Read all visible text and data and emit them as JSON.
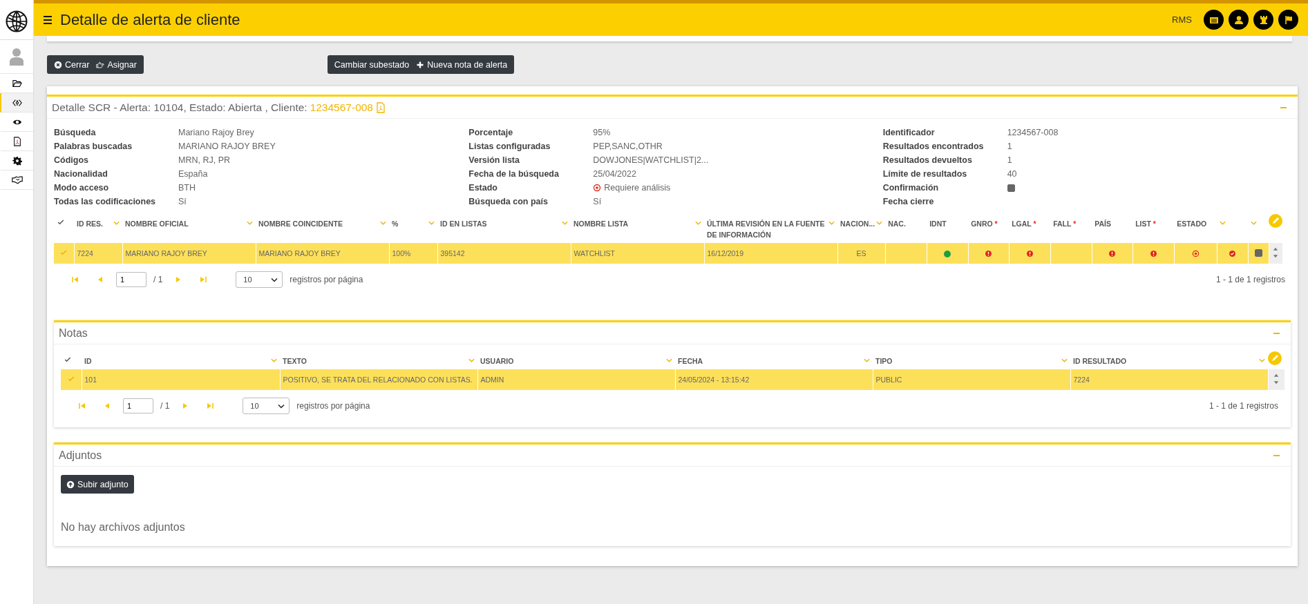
{
  "header": {
    "title": "Detalle de alerta de cliente",
    "user": "RMS",
    "buttons": [
      {
        "kind": "card"
      },
      {
        "kind": "user"
      },
      {
        "kind": "rook"
      },
      {
        "kind": "flag"
      }
    ]
  },
  "sidebar": {
    "items": [
      {
        "kind": "folder",
        "selected": false
      },
      {
        "kind": "code",
        "selected": true
      },
      {
        "kind": "eye",
        "selected": false
      },
      {
        "kind": "pdf",
        "selected": false
      },
      {
        "kind": "gear",
        "selected": false
      },
      {
        "kind": "handshake",
        "selected": false
      }
    ]
  },
  "toolbar": {
    "left": [
      {
        "label": "Cerrar",
        "kind": "close"
      },
      {
        "label": "Asignar",
        "kind": "hand"
      }
    ],
    "right": [
      {
        "label": "Cambiar subestado",
        "kind": "plain"
      },
      {
        "label": "Nueva nota de alerta",
        "kind": "plus"
      }
    ]
  },
  "detail": {
    "title": "Detalle SCR - Alerta: 10104, Estado: Abierta , Cliente:",
    "client_link": "1234567-008",
    "field_columns": [
      [
        {
          "label": "Búsqueda",
          "value": "Mariano Rajoy Brey",
          "kind": "text"
        },
        {
          "label": "Palabras buscadas",
          "value": "MARIANO RAJOY BREY",
          "kind": "text"
        },
        {
          "label": "Códigos",
          "value": "MRN, RJ, PR",
          "kind": "text"
        },
        {
          "label": "Nacionalidad",
          "value": "España",
          "kind": "text"
        },
        {
          "label": "Modo acceso",
          "value": "BTH",
          "kind": "text"
        },
        {
          "label": "Todas las codificaciones",
          "value": "Sí",
          "kind": "text"
        }
      ],
      [
        {
          "label": "Porcentaje",
          "value": "95%",
          "kind": "text"
        },
        {
          "label": "Listas configuradas",
          "value": "PEP,SANC,OTHR",
          "kind": "text"
        },
        {
          "label": "Versión lista",
          "value": "DOWJONES|WATCHLIST|2...",
          "kind": "text"
        },
        {
          "label": "Fecha de la búsqueda",
          "value": "25/04/2022",
          "kind": "text"
        },
        {
          "label": "Estado",
          "value": "Requiere análisis",
          "kind": "status"
        },
        {
          "label": "Búsqueda con país",
          "value": "Sí",
          "kind": "text"
        }
      ],
      [
        {
          "label": "Identificador",
          "value": "1234567-008",
          "kind": "text"
        },
        {
          "label": "Resultados encontrados",
          "value": "1",
          "kind": "text"
        },
        {
          "label": "Resultados devueltos",
          "value": "1",
          "kind": "text"
        },
        {
          "label": "Límite de resultados",
          "value": "40",
          "kind": "text"
        },
        {
          "label": "Confirmación",
          "kind": "checkbox",
          "checked": true
        },
        {
          "label": "Fecha cierre",
          "kind": "text"
        }
      ]
    ],
    "table": {
      "columns": [
        {
          "label": "ID RES.",
          "filter": true
        },
        {
          "label": "NOMBRE OFICIAL",
          "filter": true
        },
        {
          "label": "NOMBRE COINCIDENTE",
          "filter": true
        },
        {
          "label": "%",
          "filter": true
        },
        {
          "label": "ID EN LISTAS",
          "filter": true
        },
        {
          "label": "NOMBRE LISTA",
          "filter": true
        },
        {
          "label": "ÚLTIMA REVISIÓN EN LA FUENTE DE INFORMACIÓN",
          "filter": true
        },
        {
          "label": "NACION...",
          "filter": true
        },
        {
          "label": "NAC.",
          "filter": false
        },
        {
          "label": "IDNT",
          "filter": false
        },
        {
          "label": "GNRO",
          "required_mark": "*",
          "filter": false
        },
        {
          "label": "LGAL",
          "required_mark": "*",
          "filter": false
        },
        {
          "label": "FALL",
          "required_mark": "*",
          "filter": false
        },
        {
          "label": "PAÍS",
          "filter": false
        },
        {
          "label": "LIST",
          "required_mark": "*",
          "filter": false
        },
        {
          "label": "ESTADO",
          "filter": false
        },
        {
          "filter": true
        },
        {
          "filter": true
        }
      ],
      "rows": [
        {
          "selected": true,
          "cells": [
            {
              "kind": "text",
              "text": "7224"
            },
            {
              "kind": "text",
              "text": "MARIANO RAJOY BREY"
            },
            {
              "kind": "text",
              "text": "MARIANO RAJOY BREY"
            },
            {
              "kind": "text",
              "text": "100%"
            },
            {
              "kind": "text",
              "text": "395142"
            },
            {
              "kind": "text",
              "text": "WATCHLIST"
            },
            {
              "kind": "text",
              "text": "16/12/2019"
            },
            {
              "kind": "center",
              "text": "ES"
            },
            {
              "kind": "blank"
            },
            {
              "kind": "dot",
              "color": "#1e9e3e"
            },
            {
              "kind": "alert"
            },
            {
              "kind": "alert"
            },
            {
              "kind": "blank"
            },
            {
              "kind": "alert"
            },
            {
              "kind": "alert"
            },
            {
              "kind": "target"
            },
            {
              "kind": "check"
            },
            {
              "kind": "checkbox",
              "checked": true
            }
          ]
        }
      ],
      "pager": {
        "page": "1",
        "pages": "/ 1",
        "page_size": "10",
        "per_page": "registros por página",
        "summary": "1 - 1 de 1 registros"
      }
    }
  },
  "notes": {
    "title": "Notas",
    "table": {
      "columns": [
        {
          "label": "ID",
          "filter": true
        },
        {
          "label": "TEXTO",
          "filter": true
        },
        {
          "label": "USUARIO",
          "filter": true
        },
        {
          "label": "FECHA",
          "filter": true
        },
        {
          "label": "TIPO",
          "filter": true
        },
        {
          "label": "ID RESULTADO",
          "filter": true
        }
      ],
      "rows": [
        {
          "selected": true,
          "cells": [
            {
              "kind": "text",
              "text": "101"
            },
            {
              "kind": "text",
              "text": "POSITIVO, SE TRATA DEL RELACIONADO CON LISTAS."
            },
            {
              "kind": "text",
              "text": "ADMIN"
            },
            {
              "kind": "text",
              "text": "24/05/2024 - 13:15:42"
            },
            {
              "kind": "text",
              "text": "PUBLIC"
            },
            {
              "kind": "text",
              "text": "7224"
            }
          ]
        }
      ],
      "pager": {
        "page": "1",
        "pages": "/ 1",
        "page_size": "10",
        "per_page": "registros por página",
        "summary": "1 - 1 de 1 registros"
      }
    }
  },
  "attachments": {
    "title": "Adjuntos",
    "button": "Subir adjunto",
    "empty_message": "No hay archivos adjuntos"
  }
}
